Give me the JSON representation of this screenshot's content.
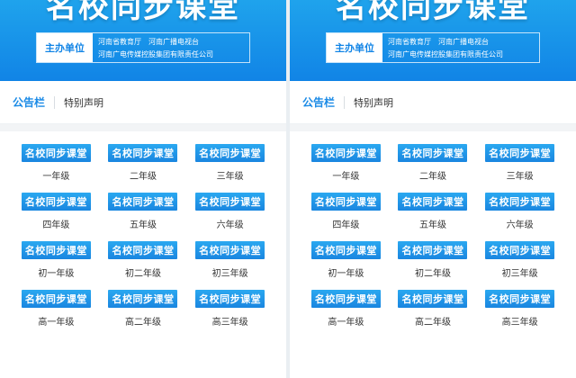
{
  "banner": {
    "title": "名校同步课堂",
    "sponsor_label": "主办单位",
    "sponsor_line1": "河南省教育厅　河南广播电视台",
    "sponsor_line2": "河南广电传媒控股集团有限责任公司"
  },
  "notice": {
    "title": "公告栏",
    "text": "特别声明"
  },
  "grades": [
    {
      "badge": "名校同步课堂",
      "label": "一年级"
    },
    {
      "badge": "名校同步课堂",
      "label": "二年级"
    },
    {
      "badge": "名校同步课堂",
      "label": "三年级"
    },
    {
      "badge": "名校同步课堂",
      "label": "四年级"
    },
    {
      "badge": "名校同步课堂",
      "label": "五年级"
    },
    {
      "badge": "名校同步课堂",
      "label": "六年级"
    },
    {
      "badge": "名校同步课堂",
      "label": "初一年级"
    },
    {
      "badge": "名校同步课堂",
      "label": "初二年级"
    },
    {
      "badge": "名校同步课堂",
      "label": "初三年级"
    },
    {
      "badge": "名校同步课堂",
      "label": "高一年级"
    },
    {
      "badge": "名校同步课堂",
      "label": "高二年级"
    },
    {
      "badge": "名校同步课堂",
      "label": "高三年级"
    }
  ],
  "colors": {
    "brand_blue": "#1184e6",
    "accent_blue": "#1a8ae6"
  }
}
